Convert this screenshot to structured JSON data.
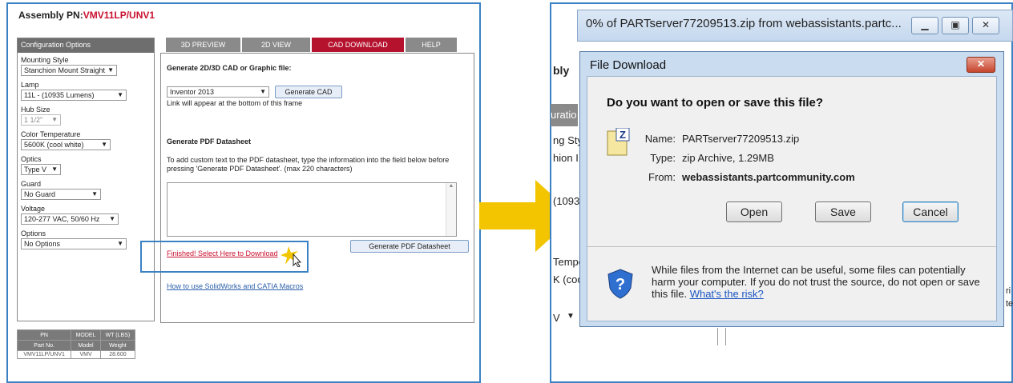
{
  "left": {
    "assembly_label": "Assembly PN:",
    "assembly_pn": "VMV11LP/UNV1",
    "config_header": "Configuration Options",
    "fields": [
      {
        "label": "Mounting Style",
        "value": "Stanchion Mount Straight"
      },
      {
        "label": "Lamp",
        "value": "11L - (10935 Lumens)"
      },
      {
        "label": "Hub Size",
        "value": "1 1/2\""
      },
      {
        "label": "Color Temperature",
        "value": "5600K (cool white)"
      },
      {
        "label": "Optics",
        "value": "Type V"
      },
      {
        "label": "Guard",
        "value": "No Guard"
      },
      {
        "label": "Voltage",
        "value": "120-277 VAC, 50/60 Hz"
      },
      {
        "label": "Options",
        "value": "No Options"
      }
    ],
    "tabs": [
      "3D PREVIEW",
      "2D VIEW",
      "CAD DOWNLOAD",
      "HELP"
    ],
    "cad_heading": "Generate 2D/3D CAD or Graphic file:",
    "cad_format": "Inventor 2013",
    "generate_cad": "Generate CAD",
    "link_note": "Link will appear at the bottom of this frame",
    "pdf_heading": "Generate PDF Datasheet",
    "pdf_text": "To add custom text to the PDF datasheet, type the information into the field below before pressing 'Generate PDF Datasheet'. (max 220 characters)",
    "generate_pdf": "Generate PDF Datasheet",
    "download_link": "Finished! Select Here to Download",
    "macros_link": "How to use SolidWorks and CATIA Macros",
    "table": {
      "headers": [
        "PN",
        "MODEL",
        "WT (LBS)"
      ],
      "subheaders": [
        "Part No.",
        "Model",
        "Weight"
      ],
      "row": [
        "VMV11LP/UNV1",
        "VMV",
        "28.600"
      ]
    }
  },
  "right": {
    "bg_texts": [
      "bly",
      "uratio",
      "ng Sty",
      "hion I",
      "(1093",
      "Tempe",
      "K (coo",
      "V",
      "ri",
      "te"
    ],
    "progress_title": "0% of PARTserver77209513.zip from webassistants.partc...",
    "dialog_title": "File Download",
    "question": "Do you want to open or save this file?",
    "name_label": "Name:",
    "name_value": "PARTserver77209513.zip",
    "type_label": "Type:",
    "type_value": "zip Archive, 1.29MB",
    "from_label": "From:",
    "from_value": "webassistants.partcommunity.com",
    "open_btn": "Open",
    "save_btn": "Save",
    "cancel_btn": "Cancel",
    "warning": "While files from the Internet can be useful, some files can potentially harm your computer. If you do not trust the source, do not open or save this file.",
    "risk_link": "What's the risk?",
    "colors": {
      "arrow": "#f2c500",
      "frame": "#3b82c4",
      "accent_red": "#c8102e"
    }
  }
}
